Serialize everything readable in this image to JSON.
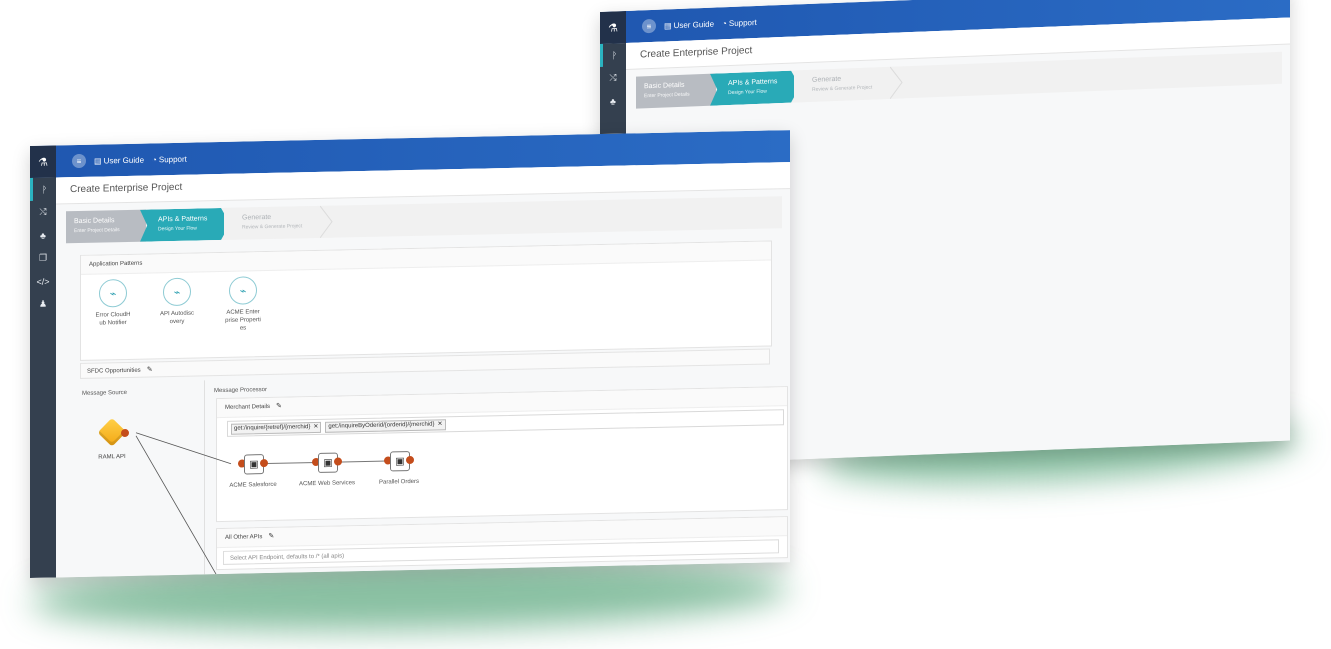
{
  "app": {
    "logo_icon": "flask-icon",
    "user_guide": "User Guide",
    "support": "Support",
    "page_title": "Create Enterprise Project"
  },
  "wizard": [
    {
      "title": "Basic Details",
      "subtitle": "Enter Project Details",
      "state": "completed"
    },
    {
      "title": "APIs & Patterns",
      "subtitle": "Design Your Flow",
      "state": "active"
    },
    {
      "title": "Generate",
      "subtitle": "Review & Generate Project",
      "state": "pending"
    }
  ],
  "application_patterns": {
    "title": "Application Patterns",
    "items": [
      {
        "label": "Error CloudHub Notifier"
      },
      {
        "label": "API Autodiscovery"
      },
      {
        "label": "ACME Enterprise Properties"
      }
    ]
  },
  "flow": {
    "title": "SFDC Opportunities",
    "message_source_label": "Message Source",
    "message_processor_label": "Message Processor",
    "source": {
      "label": "RAML API"
    },
    "merchant": {
      "title": "Merchant Details",
      "endpoints": [
        {
          "text": "get:/inquire/{retref}/{merchid}"
        },
        {
          "text": "get:/inquireByOderid/{orderid}/{merchid}"
        }
      ],
      "nodes": [
        {
          "label": "ACME Salesforce"
        },
        {
          "label": "ACME Web Services"
        },
        {
          "label": "Parallel Orders"
        }
      ]
    },
    "other_apis": {
      "title": "All Other APIs",
      "placeholder": "Select API Endpoint, defaults to /* (all apis)"
    }
  },
  "colors": {
    "topbar": "#2b6cc5",
    "sidebar": "#34404f",
    "active_step": "#29aab7",
    "port": "#c44d1c",
    "shadow": "#2f9660"
  },
  "sidebar_icons": [
    "flow-icon",
    "shuffle-icon",
    "sitemap-icon",
    "copy-icon",
    "code-icon",
    "user-add-icon"
  ]
}
